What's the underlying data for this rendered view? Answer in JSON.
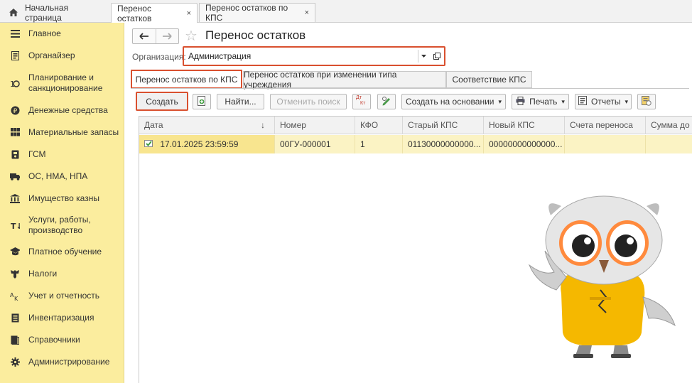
{
  "top_tabs": {
    "home": "Начальная страница",
    "active": "Перенос остатков",
    "second": "Перенос остатков по КПС",
    "close_glyph": "×"
  },
  "sidebar": {
    "items": [
      {
        "label": "Главное",
        "icon": "menu-icon"
      },
      {
        "label": "Органайзер",
        "icon": "organizer-icon"
      },
      {
        "label": "Планирование и санкционирование",
        "icon": "planning-icon"
      },
      {
        "label": "Денежные средства",
        "icon": "money-icon"
      },
      {
        "label": "Материальные запасы",
        "icon": "grid-icon"
      },
      {
        "label": "ГСМ",
        "icon": "fuel-icon"
      },
      {
        "label": "ОС, НМА, НПА",
        "icon": "truck-icon"
      },
      {
        "label": "Имущество казны",
        "icon": "treasury-icon"
      },
      {
        "label": "Услуги, работы, производство",
        "icon": "services-icon"
      },
      {
        "label": "Платное обучение",
        "icon": "graduation-icon"
      },
      {
        "label": "Налоги",
        "icon": "eagle-icon"
      },
      {
        "label": "Учет и отчетность",
        "icon": "accounting-icon"
      },
      {
        "label": "Инвентаризация",
        "icon": "inventory-icon"
      },
      {
        "label": "Справочники",
        "icon": "reference-icon"
      },
      {
        "label": "Администрирование",
        "icon": "gear-icon"
      }
    ]
  },
  "header": {
    "back_glyph": "🡐",
    "forward_glyph": "🡒",
    "star_glyph": "☆",
    "title": "Перенос остатков"
  },
  "organization": {
    "label": "Организация:",
    "value": "Администрация"
  },
  "subtabs": [
    "Перенос остатков по КПС",
    "Перенос остатков при изменении типа учреждения",
    "Соответствие КПС"
  ],
  "toolbar": {
    "create": "Создать",
    "find": "Найти...",
    "cancel_search": "Отменить поиск",
    "create_based_on": "Создать на основании",
    "print": "Печать",
    "reports": "Отчеты",
    "dtkt_top": "Дт",
    "dtkt_bottom": "Кт",
    "dropdown_glyph": "▾"
  },
  "table": {
    "columns": [
      "Дата",
      "Номер",
      "КФО",
      "Старый КПС",
      "Новый КПС",
      "Счета переноса",
      "Сумма до"
    ],
    "sort_glyph": "↓",
    "rows": [
      [
        "17.01.2025 23:59:59",
        "00ГУ-000001",
        "1",
        "01130000000000...",
        "00000000000000...",
        "",
        ""
      ]
    ]
  },
  "colors": {
    "sidebar_bg": "#fbed9e",
    "highlight": "#d9502f",
    "row_selected": "#fbf3c4"
  }
}
